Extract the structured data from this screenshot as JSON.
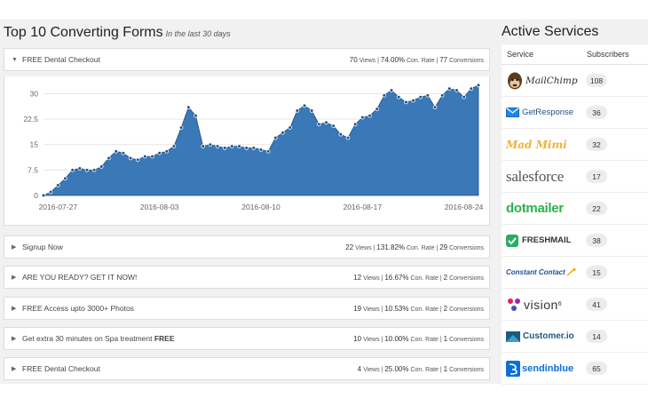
{
  "forms_section": {
    "title": "Top 10 Converting Forms",
    "subtitle": "In the last 30 days"
  },
  "forms": [
    {
      "name": "FREE Dental Checkout",
      "name_bold": "",
      "views": "70",
      "views_label": "Views",
      "rate": "74.00%",
      "rate_label": "Con. Rate",
      "conversions": "77",
      "conversions_label": "Conversions",
      "expanded": true
    },
    {
      "name": "Signup Now",
      "name_bold": "",
      "views": "22",
      "views_label": "Views",
      "rate": "131.82%",
      "rate_label": "Con. Rate",
      "conversions": "29",
      "conversions_label": "Conversions",
      "expanded": false
    },
    {
      "name": "ARE YOU READY? GET IT NOW!",
      "name_bold": "",
      "views": "12",
      "views_label": "Views",
      "rate": "16.67%",
      "rate_label": "Con. Rate",
      "conversions": "2",
      "conversions_label": "Conversions",
      "expanded": false
    },
    {
      "name": "FREE Access upto 3000+ Photos",
      "name_bold": "",
      "views": "19",
      "views_label": "Views",
      "rate": "10.53%",
      "rate_label": "Con. Rate",
      "conversions": "2",
      "conversions_label": "Conversions",
      "expanded": false
    },
    {
      "name": "Get extra 30 minutes on Spa treatment ",
      "name_bold": "FREE",
      "views": "10",
      "views_label": "Views",
      "rate": "10.00%",
      "rate_label": "Con. Rate",
      "conversions": "1",
      "conversions_label": "Conversions",
      "expanded": false
    },
    {
      "name": "FREE Dental Checkout",
      "name_bold": "",
      "views": "4",
      "views_label": "Views",
      "rate": "25.00%",
      "rate_label": "Con. Rate",
      "conversions": "1",
      "conversions_label": "Conversions",
      "expanded": false
    }
  ],
  "chart_data": {
    "type": "area",
    "x": [
      "2016-07-26",
      "2016-07-27",
      "2016-07-28",
      "2016-07-29",
      "2016-07-30",
      "2016-07-31",
      "2016-08-01",
      "2016-08-02",
      "2016-08-03",
      "2016-08-04",
      "2016-08-05",
      "2016-08-06",
      "2016-08-07",
      "2016-08-08",
      "2016-08-09",
      "2016-08-10",
      "2016-08-11",
      "2016-08-12",
      "2016-08-13",
      "2016-08-14",
      "2016-08-15",
      "2016-08-16",
      "2016-08-17",
      "2016-08-18",
      "2016-08-19",
      "2016-08-20",
      "2016-08-21",
      "2016-08-22",
      "2016-08-23",
      "2016-08-24",
      "2016-08-25"
    ],
    "y": [
      0,
      1,
      3,
      5,
      7.5,
      8,
      7.5,
      7.5,
      8.5,
      11,
      13,
      12.5,
      11,
      10.5,
      11.5,
      11.5,
      12.5,
      13,
      14.5,
      20,
      26,
      23.5,
      14.5,
      15,
      14.5,
      14,
      14.5,
      14.5,
      14,
      14,
      13.5,
      13,
      17,
      18.5,
      20,
      25,
      26.5,
      25,
      21,
      21.5,
      20.5,
      18,
      17,
      21,
      23,
      23.5,
      25.5,
      29.5,
      31,
      29,
      27.5,
      28,
      29,
      29.5,
      26,
      29.5,
      31.5,
      31,
      29,
      31.5,
      32.5
    ],
    "xticks": [
      "2016-07-27",
      "2016-08-03",
      "2016-08-10",
      "2016-08-17",
      "2016-08-24"
    ],
    "yticks": [
      "0",
      "7.5",
      "15",
      "22.5",
      "30"
    ],
    "ylim": [
      0,
      33
    ],
    "color": "#3a78b8",
    "marker_color": "#1f4f86",
    "grid": "horizontal"
  },
  "services": {
    "title": "Active Services",
    "col_service": "Service",
    "col_subscribers": "Subscribers",
    "items": [
      {
        "name": "MailChimp",
        "icon": "mailchimp-monkey-icon",
        "subscribers": "108"
      },
      {
        "name": "GetResponse",
        "icon": "getresponse-envelope-icon",
        "subscribers": "36"
      },
      {
        "name": "Mad Mimi",
        "icon": "",
        "subscribers": "32"
      },
      {
        "name": "salesforce",
        "icon": "",
        "subscribers": "17"
      },
      {
        "name": "dotmailer",
        "icon": "",
        "subscribers": "22"
      },
      {
        "name": "FRESHMAIL",
        "icon": "freshmail-logo-icon",
        "subscribers": "38"
      },
      {
        "name": "Constant Contact",
        "icon": "constant-contact-star-icon",
        "subscribers": "15"
      },
      {
        "name": "vision",
        "name_sup": "6",
        "icon": "vision6-logo-icon",
        "subscribers": "41"
      },
      {
        "name": "Customer.io",
        "icon": "customerio-logo-icon",
        "subscribers": "14"
      },
      {
        "name": "sendinblue",
        "icon": "sendinblue-logo-icon",
        "subscribers": "65"
      }
    ]
  }
}
